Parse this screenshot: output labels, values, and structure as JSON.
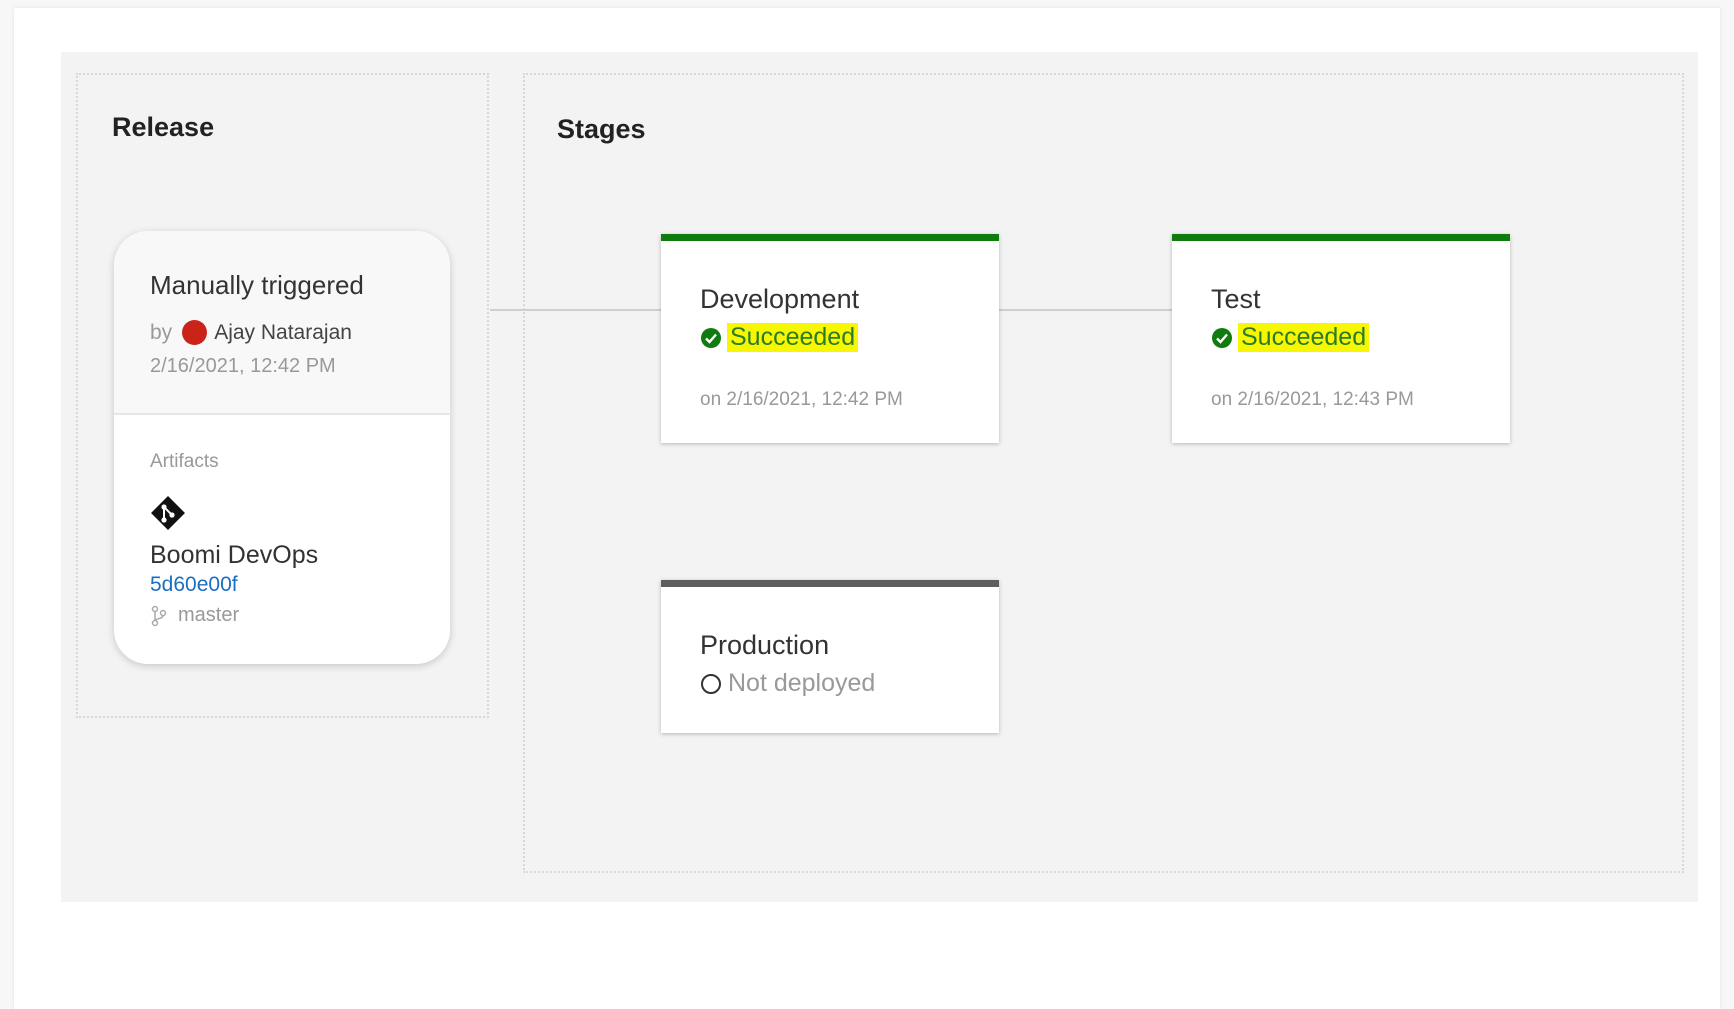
{
  "release": {
    "title": "Release",
    "card": {
      "trigger": "Manually triggered",
      "by_label": "by",
      "user": "Ajay Natarajan",
      "date": "2/16/2021, 12:42 PM",
      "artifacts_label": "Artifacts",
      "artifact_icon": "git-icon",
      "artifact_name": "Boomi DevOps",
      "commit": "5d60e00f",
      "branch_icon": "branch-icon",
      "branch": "master"
    }
  },
  "stages": {
    "title": "Stages",
    "items": [
      {
        "name": "Development",
        "status": "Succeeded",
        "status_icon": "check-circle-icon",
        "when": "on 2/16/2021, 12:42 PM",
        "accent": "#107c10"
      },
      {
        "name": "Test",
        "status": "Succeeded",
        "status_icon": "check-circle-icon",
        "when": "on 2/16/2021, 12:43 PM",
        "accent": "#107c10"
      },
      {
        "name": "Production",
        "status": "Not deployed",
        "status_icon": "empty-circle-icon",
        "accent": "#5e5e5e"
      }
    ]
  },
  "colors": {
    "success": "#107c10",
    "highlight": "#f7f700",
    "link": "#1a6fc1",
    "avatar": "#c9231a"
  }
}
